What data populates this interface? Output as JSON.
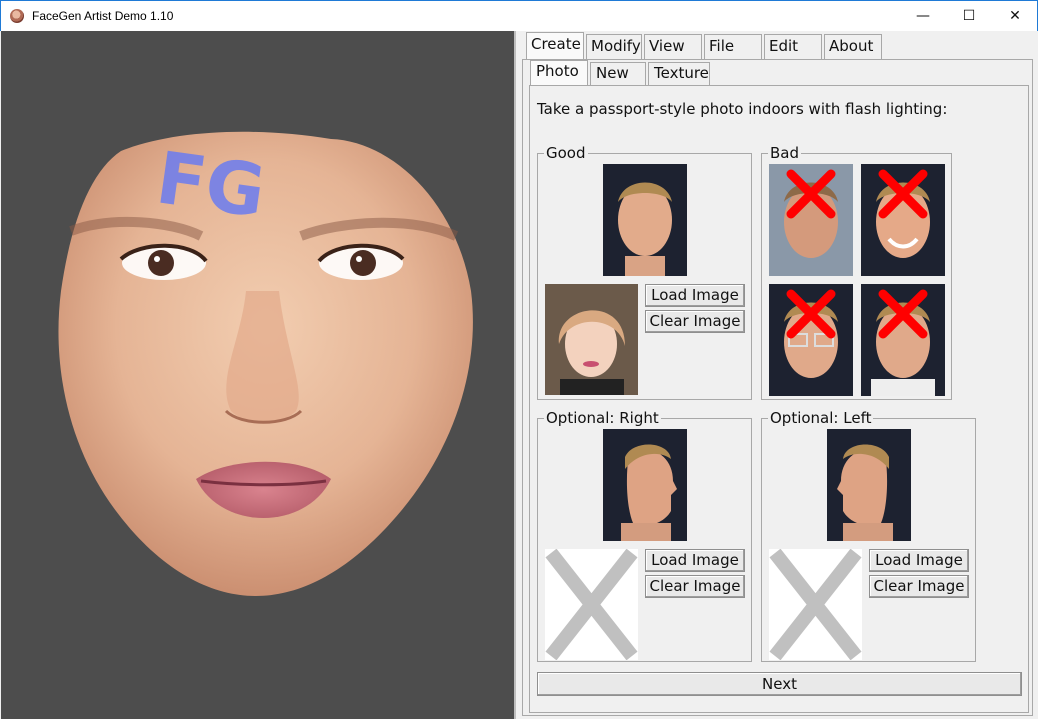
{
  "window": {
    "title": "FaceGen Artist Demo 1.10",
    "min_glyph": "—",
    "max_glyph": "☐",
    "close_glyph": "✕"
  },
  "viewport": {
    "forehead_text": "FG"
  },
  "tabs": [
    "Create",
    "Modify",
    "View",
    "File",
    "Edit",
    "About"
  ],
  "subtabs": [
    "Photo",
    "New",
    "Texture"
  ],
  "instructions": "Take a passport-style photo indoors with flash lighting:",
  "groups": {
    "good": {
      "label": "Good",
      "load": "Load Image",
      "clear": "Clear Image"
    },
    "bad": {
      "label": "Bad"
    },
    "right": {
      "label": "Optional: Right",
      "load": "Load Image",
      "clear": "Clear Image"
    },
    "left": {
      "label": "Optional: Left",
      "load": "Load Image",
      "clear": "Clear Image"
    }
  },
  "next_label": "Next",
  "colors": {
    "title_border": "#1f7ad6",
    "viewport_bg": "#4d4d4d",
    "bad_x": "#ff0000",
    "fg_text": "#6b7cf0"
  }
}
